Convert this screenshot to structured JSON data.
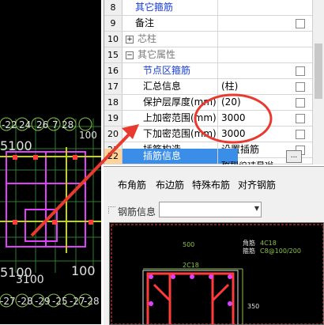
{
  "grid": {
    "rows": [
      {
        "num": "8",
        "name": "其它箍筋",
        "value": "",
        "checkbox": false,
        "name_color": "blue"
      },
      {
        "num": "9",
        "name": "备注",
        "value": "",
        "checkbox": true,
        "name_color": "black"
      },
      {
        "num": "10",
        "name": "芯柱",
        "value": "",
        "checkbox": false,
        "name_color": "gray",
        "expander": "+"
      },
      {
        "num": "15",
        "name": "其它属性",
        "value": "",
        "checkbox": false,
        "name_color": "gray",
        "expander": "−"
      },
      {
        "num": "16",
        "name": "节点区箍筋",
        "value": "",
        "checkbox": true,
        "name_color": "blue"
      },
      {
        "num": "17",
        "name": "汇总信息",
        "value": "(柱)",
        "checkbox": true,
        "name_color": "black"
      },
      {
        "num": "18",
        "name": "保护层厚度(mm)",
        "value": "(20)",
        "checkbox": true,
        "name_color": "black"
      },
      {
        "num": "19",
        "name": "上加密范围(mm)",
        "value": "3000",
        "checkbox": true,
        "name_color": "black"
      },
      {
        "num": "20",
        "name": "下加密范围(mm)",
        "value": "3000",
        "checkbox": true,
        "name_color": "black"
      },
      {
        "num": "21",
        "name": "插筋构造",
        "value": "设置插筋",
        "checkbox": true,
        "name_color": "black"
      },
      {
        "num": "22",
        "name": "插筋信息",
        "value": "",
        "checkbox": false,
        "name_color": "white",
        "selected": true,
        "ellipsis": "..."
      }
    ],
    "partial_row_value": "按规范计算设"
  },
  "toolbar": {
    "tabs": [
      "布角筋",
      "布边筋",
      "特殊布筋",
      "对齐钢筋"
    ],
    "rebar_info_label": "钢筋信息",
    "rebar_info_value": ""
  },
  "cad": {
    "labels": [
      "-22",
      "24",
      "26",
      "7",
      "28",
      "100",
      "5100",
      "100",
      "5100",
      "3100",
      "-27",
      "-28",
      "-29",
      "-25",
      "-27",
      "-28"
    ]
  },
  "preview": {
    "dim_top": "500",
    "dim_right": "350",
    "corner_label": "角筋",
    "corner_value": "4C18",
    "stirrup_label": "箍筋",
    "stirrup_value": "C8@100/200",
    "top_label": "2C18"
  },
  "annotation": {
    "ellipse_color": "#e83a2f",
    "arrow_color": "#e83a2f"
  },
  "colors": {
    "selected_row": "#3b8ee8",
    "selected_num": "#ffd39a",
    "link_blue": "#1a3fd6"
  }
}
